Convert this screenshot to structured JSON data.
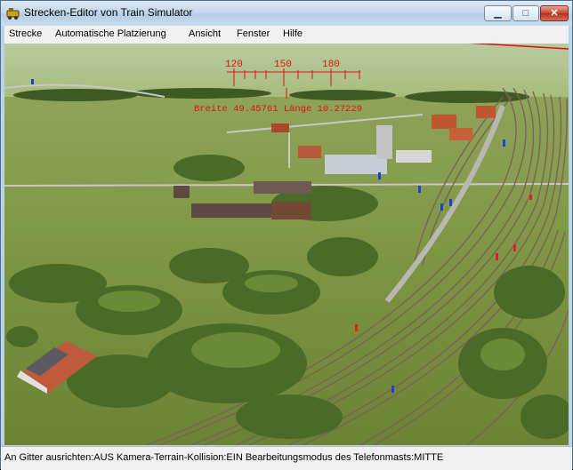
{
  "window": {
    "title": "Strecken-Editor von Train Simulator",
    "controls": {
      "minimize": "▁",
      "maximize": "□",
      "close": "✕"
    }
  },
  "menu": {
    "items": [
      "Strecke",
      "Automatische Platzierung",
      "Ansicht",
      "Fenster",
      "Hilfe"
    ]
  },
  "hud": {
    "compass_labels": [
      "120",
      "150",
      "180"
    ],
    "coordinates": "Breite 49.45761 Länge 10.27229"
  },
  "status": {
    "text": "An Gitter ausrichten:AUS Kamera-Terrain-Kollision:EIN Bearbeitungsmodus des Telefonmasts:MITTE"
  },
  "colors": {
    "hud_red": "#e01010",
    "terrain_green": "#6f8a3a",
    "track_brown": "#7a6058"
  },
  "icons": {
    "app": "train-simulator-app-icon"
  }
}
